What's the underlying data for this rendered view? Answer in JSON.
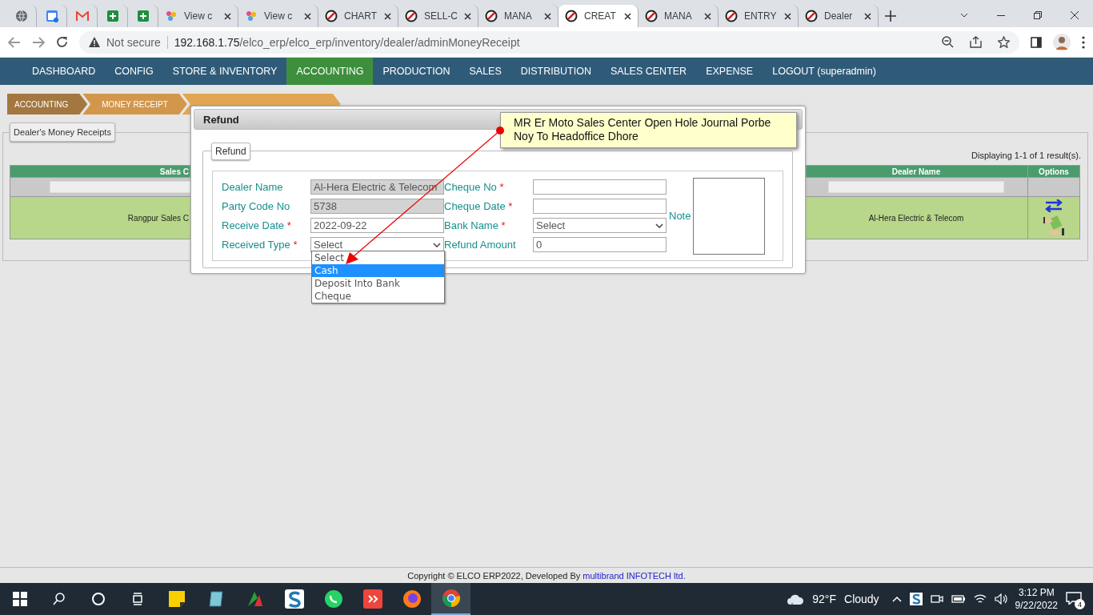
{
  "browser": {
    "tabs": [
      {
        "selected": false
      },
      {
        "selected": false
      },
      {
        "selected": false
      },
      {
        "selected": false
      },
      {
        "selected": false
      },
      {
        "title": "View c",
        "selected": false
      },
      {
        "title": "View c",
        "selected": false
      },
      {
        "title": "CHART",
        "selected": false
      },
      {
        "title": "SELL-C",
        "selected": false
      },
      {
        "title": "MANA",
        "selected": false
      },
      {
        "title": "CREAT",
        "selected": true
      },
      {
        "title": "MANA",
        "selected": false
      },
      {
        "title": "ENTRY",
        "selected": false
      },
      {
        "title": "Dealer",
        "selected": false
      }
    ],
    "security": "Not secure",
    "host": "192.168.1.75",
    "path": "/elco_erp/elco_erp/inventory/dealer/adminMoneyReceipt"
  },
  "nav": [
    {
      "label": "DASHBOARD",
      "selected": false
    },
    {
      "label": "CONFIG",
      "selected": false
    },
    {
      "label": "STORE & INVENTORY",
      "selected": false
    },
    {
      "label": "ACCOUNTING",
      "selected": true
    },
    {
      "label": "PRODUCTION",
      "selected": false
    },
    {
      "label": "SALES",
      "selected": false
    },
    {
      "label": "DISTRIBUTION",
      "selected": false
    },
    {
      "label": "SALES CENTER",
      "selected": false
    },
    {
      "label": "EXPENSE",
      "selected": false
    },
    {
      "label": "LOGOUT (superadmin)",
      "selected": false
    }
  ],
  "breadcrumb": [
    "ACCOUNTING",
    "MONEY RECEIPT"
  ],
  "panel": {
    "legend": "Dealer's Money Receipts",
    "summary": "Displaying 1-1 of 1 result(s).",
    "columns": [
      "Sales C",
      "Dealer Name",
      "Options"
    ],
    "rows": [
      {
        "cells": [
          "Rangpur Sales C",
          "Al-Hera Electric & Telecom"
        ]
      }
    ]
  },
  "modal": {
    "title": "Refund",
    "legend": "Refund",
    "left_fields": [
      {
        "kind": "text",
        "label": "Dealer Name",
        "value": "Al-Hera Electric & Telecom",
        "readonly": true
      },
      {
        "kind": "text",
        "label": "Party Code No",
        "value": "5738",
        "readonly": true
      },
      {
        "kind": "text",
        "label": "Receive Date",
        "required_mark": "*",
        "value": "2022-09-22",
        "readonly": false
      },
      {
        "kind": "select",
        "label": "Received Type",
        "required_mark": "*",
        "value": "Select",
        "open": true,
        "options": [
          {
            "label": "Select",
            "highlighted": false
          },
          {
            "label": "Cash",
            "highlighted": true
          },
          {
            "label": "Deposit Into Bank",
            "highlighted": false
          },
          {
            "label": "Cheque",
            "highlighted": false
          }
        ]
      }
    ],
    "right_fields": [
      {
        "kind": "text",
        "label": "Cheque No",
        "required_mark": "*",
        "readonly": false
      },
      {
        "kind": "text",
        "label": "Cheque Date",
        "required_mark": "*",
        "readonly": false
      },
      {
        "kind": "select",
        "label": "Bank Name",
        "required_mark": "*",
        "value": "Select"
      },
      {
        "kind": "text",
        "label": "Refund Amount",
        "value": "0",
        "readonly": false
      }
    ],
    "note_label": "Note"
  },
  "annotation": {
    "text": "MR Er Moto Sales Center Open Hole Journal Porbe Noy To Headoffice Dhore"
  },
  "footer": {
    "text": "Copyright © ELCO ERP2022, Developed By ",
    "link": "multibrand INFOTECH ltd."
  },
  "taskbar": {
    "apps": [
      {
        "selected": false
      },
      {
        "selected": false
      },
      {
        "selected": false
      },
      {
        "selected": false
      },
      {
        "selected": false
      },
      {
        "selected": false
      },
      {
        "selected": false
      },
      {
        "selected": false
      },
      {
        "selected": false
      },
      {
        "selected": false
      },
      {
        "selected": true
      }
    ],
    "temperature": "92°F",
    "weather": "Cloudy",
    "time": "3:12 PM",
    "date": "9/22/2022",
    "notifications": "4"
  }
}
